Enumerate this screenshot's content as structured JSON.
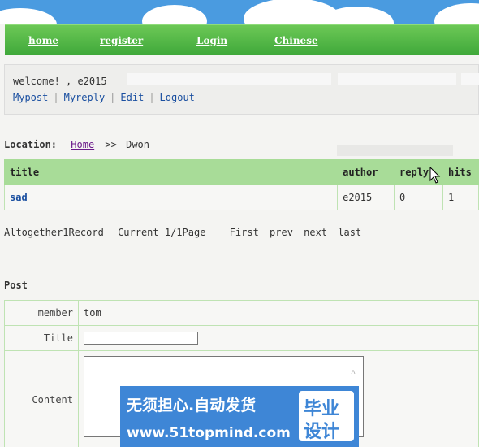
{
  "nav": {
    "items": [
      {
        "label": "home"
      },
      {
        "label": "register"
      },
      {
        "label": "Login"
      },
      {
        "label": "Chinese"
      }
    ]
  },
  "user_panel": {
    "welcome": "welcome! , e2015",
    "links": [
      "Mypost",
      "Myreply",
      "Edit",
      "Logout"
    ]
  },
  "location": {
    "label": "Location:",
    "home": "Home",
    "separator": ">>",
    "current": "Dwon"
  },
  "topics": {
    "headers": [
      "title",
      "author",
      "reply",
      "hits"
    ],
    "rows": [
      {
        "title": "sad",
        "author": "e2015",
        "reply": "0",
        "hits": "1"
      }
    ]
  },
  "pager": {
    "summary": "Altogether1Record",
    "current": "Current 1/1Page",
    "first": "First",
    "prev": "prev",
    "next": "next",
    "last": "last"
  },
  "post": {
    "heading": "Post",
    "member_label": "member",
    "member_value": "tom",
    "title_label": "Title",
    "title_value": "",
    "content_label": "Content",
    "content_value": ""
  },
  "banner": {
    "slogan": "无须担心.自动发货",
    "url": "www.51topmind.com",
    "badge_line1": "毕业",
    "badge_line2": "设计"
  },
  "colors": {
    "nav_green": "#3fa83a",
    "header_green": "#a8dc98",
    "sky_blue": "#4a9be0",
    "link_blue": "#1a4fa0",
    "banner_blue": "#3e86d6"
  },
  "icons": {
    "cursor": "mouse-pointer-icon",
    "scroll_up": "chevron-up-icon"
  }
}
